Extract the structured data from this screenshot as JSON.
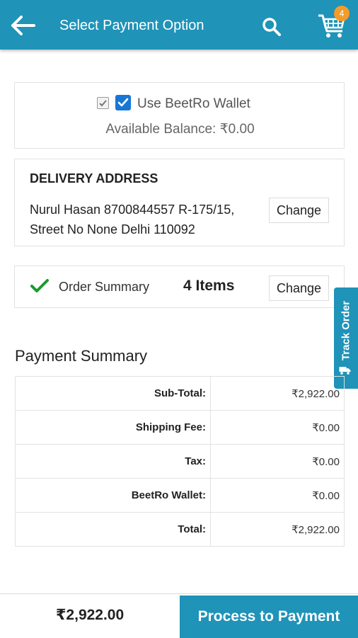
{
  "appbar": {
    "title": "Select Payment Option",
    "back_icon": "arrow-left-icon",
    "search_icon": "search-icon",
    "cart_icon": "cart-icon",
    "cart_count": "4",
    "color": "#1f93b8"
  },
  "wallet": {
    "label": "Use BeetRo Wallet",
    "checked": true,
    "balance_text": "Available Balance: ₹0.00"
  },
  "delivery": {
    "title": "DELIVERY ADDRESS",
    "address_line1": "Nurul Hasan 8700844557 R-175/15,",
    "address_line2": "Street No None Delhi 110092",
    "change_label": "Change"
  },
  "order_summary": {
    "label": "Order Summary",
    "items_text": "4 Items",
    "change_label": "Change"
  },
  "track_order": {
    "label": "Track Order",
    "icon": "truck-icon"
  },
  "payment_summary": {
    "title": "Payment Summary",
    "rows": [
      {
        "label": "Sub-Total:",
        "value": "₹2,922.00"
      },
      {
        "label": "Shipping Fee:",
        "value": "₹0.00"
      },
      {
        "label": "Tax:",
        "value": "₹0.00"
      },
      {
        "label": "BeetRo Wallet:",
        "value": "₹0.00"
      },
      {
        "label": "Total:",
        "value": "₹2,922.00"
      }
    ]
  },
  "footer": {
    "total": "₹2,922.00",
    "button_label": "Process to Payment"
  }
}
